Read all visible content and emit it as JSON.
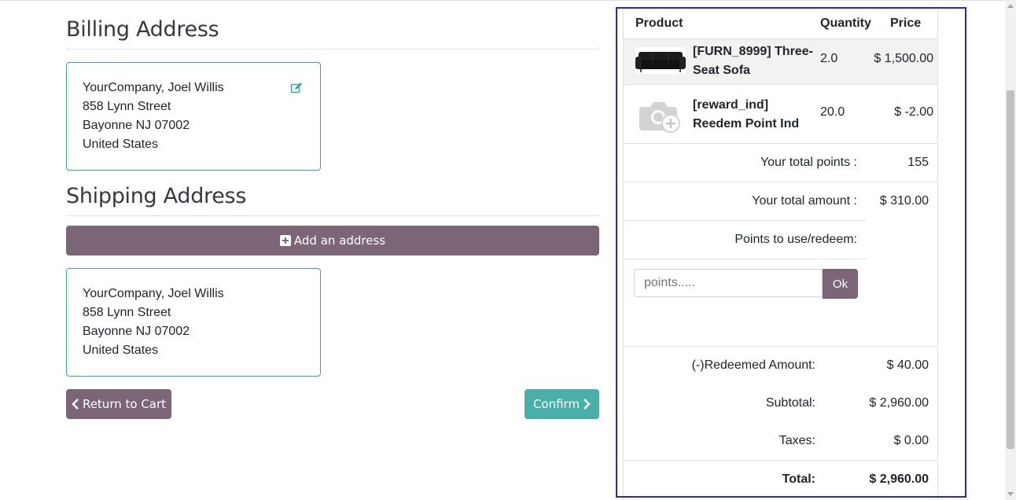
{
  "billing": {
    "title": "Billing Address",
    "lines": [
      "YourCompany, Joel Willis",
      "858 Lynn Street",
      "Bayonne NJ 07002",
      "United States"
    ]
  },
  "shipping": {
    "title": "Shipping Address",
    "add_label": "Add an address",
    "lines": [
      "YourCompany, Joel Willis",
      "858 Lynn Street",
      "Bayonne NJ 07002",
      "United States"
    ]
  },
  "actions": {
    "return_label": "Return to Cart",
    "confirm_label": "Confirm"
  },
  "order": {
    "headers": {
      "product": "Product",
      "quantity": "Quantity",
      "price": "Price"
    },
    "items": [
      {
        "name": "[FURN_8999] Three-Seat Sofa",
        "qty": "2.0",
        "price": "$ 1,500.00",
        "thumb": "sofa-image"
      },
      {
        "name": "[reward_ind] Reedem Point Ind",
        "qty": "20.0",
        "price": "$ -2.00",
        "thumb": "camera-placeholder-icon"
      }
    ],
    "total_points_label": "Your total points :",
    "total_points": "155",
    "total_amount_label": "Your total amount :",
    "total_amount": "$ 310.00",
    "redeem_label": "Points to use/redeem:",
    "points_placeholder": "points.....",
    "ok_label": "Ok",
    "redeemed_label": "(-)Redeemed Amount:",
    "redeemed_value": "$ 40.00",
    "subtotal_label": "Subtotal:",
    "subtotal_value": "$ 2,960.00",
    "taxes_label": "Taxes:",
    "taxes_value": "$ 0.00",
    "total_label": "Total:",
    "total_value": "$ 2,960.00"
  },
  "colors": {
    "accent_purple": "#7c6576",
    "accent_teal": "#49b0a9",
    "card_border": "#3aa5a0",
    "highlight_outline": "#2a21d9"
  }
}
